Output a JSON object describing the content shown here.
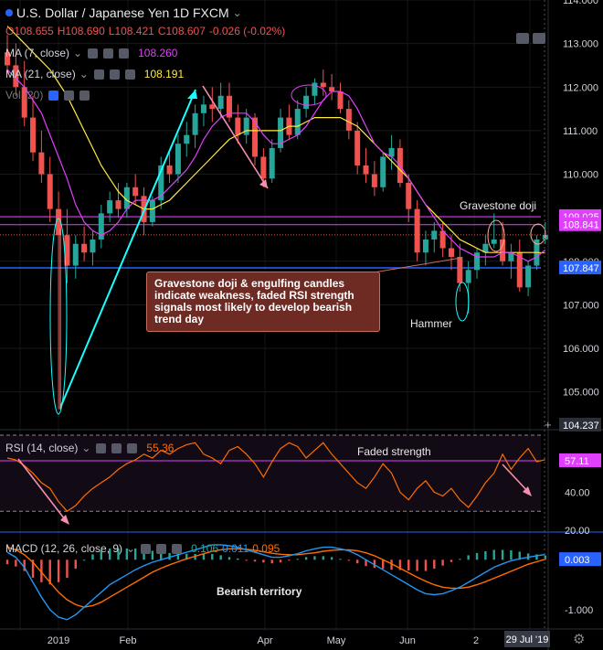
{
  "header": {
    "symbol_title": "U.S. Dollar / Japanese Yen  1D  FXCM",
    "open": "O108.655",
    "high": "H108.690",
    "low": "L108.421",
    "close": "C108.607",
    "change": "-0.026 (-0.02%)",
    "ma7_label": "MA (7, close)",
    "ma7_value": "108.260",
    "ma21_label": "MA (21, close)",
    "ma21_value": "108.191",
    "vol_label": "Vol (20)",
    "rsi_label": "RSI (14, close)",
    "rsi_value": "55.36",
    "macd_label": "MACD (12, 26, close, 9)",
    "macd_v1": "0.106",
    "macd_v2": "0.011",
    "macd_v3": "0.095"
  },
  "annotations": {
    "callout": "Gravestone doji & engulfing candles indicate weakness, faded RSI strength signals most likely to develop bearish trend day",
    "gravestone": "Gravestone doji",
    "hammer": "Hammer",
    "faded": "Faded strength",
    "bearish": "Bearish territory"
  },
  "colors": {
    "up": "#26a69a",
    "down": "#ef5350",
    "ma7": "#e040fb",
    "ma21": "#ffeb3b",
    "rsi": "#ff6d00",
    "macd": "#2196f3",
    "signal": "#ff6d00",
    "accent_blue": "#2962ff"
  },
  "icons": {
    "collapse": "chevron-down-icon",
    "settings": "gear-icon",
    "eye": "eye-icon",
    "close": "close-icon"
  },
  "chart_data": [
    {
      "type": "candlestick",
      "title": "U.S. Dollar / Japanese Yen 1D FXCM",
      "x_labels": [
        "2019",
        "Feb",
        "Apr",
        "May",
        "Jun",
        "2",
        "29 Jul '19"
      ],
      "ylim": [
        104.237,
        114.0
      ],
      "y_ticks": [
        105.0,
        106.0,
        107.0,
        108.0,
        109.0,
        110.0,
        111.0,
        112.0,
        113.0,
        114.0
      ],
      "price_tags": [
        "109.025",
        "108.841",
        "107.847",
        "104.237"
      ],
      "ohlc": [
        [
          112.8,
          113.2,
          112.3,
          112.5
        ],
        [
          112.5,
          113.0,
          111.8,
          112.0
        ],
        [
          112.0,
          112.6,
          111.1,
          111.3
        ],
        [
          111.3,
          111.8,
          110.3,
          110.5
        ],
        [
          110.5,
          111.0,
          109.8,
          110.0
        ],
        [
          110.0,
          110.4,
          108.9,
          109.2
        ],
        [
          109.2,
          109.6,
          104.6,
          108.6
        ],
        [
          108.6,
          109.2,
          107.5,
          107.9
        ],
        [
          107.9,
          108.6,
          107.6,
          108.4
        ],
        [
          108.4,
          108.8,
          108.0,
          108.2
        ],
        [
          108.2,
          108.7,
          107.9,
          108.5
        ],
        [
          108.5,
          109.3,
          108.3,
          109.1
        ],
        [
          109.1,
          109.6,
          108.9,
          109.4
        ],
        [
          109.4,
          109.8,
          109.0,
          109.2
        ],
        [
          109.2,
          109.8,
          109.0,
          109.7
        ],
        [
          109.7,
          110.0,
          109.3,
          109.5
        ],
        [
          109.5,
          109.7,
          108.6,
          108.9
        ],
        [
          108.9,
          109.5,
          108.8,
          109.4
        ],
        [
          109.4,
          110.4,
          109.2,
          110.2
        ],
        [
          110.2,
          110.5,
          109.8,
          110.0
        ],
        [
          110.0,
          110.9,
          109.8,
          110.7
        ],
        [
          110.7,
          111.2,
          110.4,
          110.9
        ],
        [
          110.9,
          111.6,
          110.6,
          111.4
        ],
        [
          111.4,
          111.8,
          111.1,
          111.6
        ],
        [
          111.6,
          112.0,
          111.2,
          111.5
        ],
        [
          111.5,
          112.1,
          111.3,
          111.8
        ],
        [
          111.8,
          112.1,
          111.2,
          111.3
        ],
        [
          111.3,
          111.6,
          110.7,
          110.9
        ],
        [
          110.9,
          111.5,
          110.7,
          111.3
        ],
        [
          111.3,
          111.4,
          110.2,
          110.4
        ],
        [
          110.4,
          110.6,
          109.7,
          109.9
        ],
        [
          109.9,
          110.8,
          109.8,
          110.6
        ],
        [
          110.6,
          111.5,
          110.5,
          111.3
        ],
        [
          111.3,
          111.6,
          110.8,
          110.9
        ],
        [
          110.9,
          111.7,
          110.8,
          111.5
        ],
        [
          111.5,
          112.0,
          111.3,
          111.8
        ],
        [
          111.8,
          112.2,
          111.6,
          112.1
        ],
        [
          112.1,
          112.4,
          111.8,
          112.0
        ],
        [
          112.0,
          112.3,
          111.7,
          111.9
        ],
        [
          111.9,
          112.1,
          111.4,
          111.5
        ],
        [
          111.5,
          111.7,
          110.8,
          111.0
        ],
        [
          111.0,
          111.2,
          110.0,
          110.2
        ],
        [
          110.2,
          110.6,
          109.8,
          110.0
        ],
        [
          110.0,
          110.3,
          109.5,
          109.7
        ],
        [
          109.7,
          110.5,
          109.6,
          110.4
        ],
        [
          110.4,
          110.9,
          110.1,
          110.6
        ],
        [
          110.6,
          110.8,
          109.7,
          109.8
        ],
        [
          109.8,
          110.0,
          108.9,
          109.2
        ],
        [
          109.2,
          109.4,
          108.0,
          108.2
        ],
        [
          108.2,
          108.7,
          107.9,
          108.5
        ],
        [
          108.5,
          108.9,
          108.2,
          108.7
        ],
        [
          108.7,
          108.9,
          108.1,
          108.3
        ],
        [
          108.3,
          108.6,
          107.8,
          108.1
        ],
        [
          108.1,
          108.4,
          107.3,
          107.5
        ],
        [
          107.5,
          108.0,
          106.8,
          107.8
        ],
        [
          107.8,
          108.3,
          107.6,
          108.2
        ],
        [
          108.2,
          108.6,
          107.9,
          108.4
        ],
        [
          108.4,
          109.1,
          108.3,
          108.5
        ],
        [
          108.5,
          108.9,
          107.9,
          108.0
        ],
        [
          108.0,
          108.4,
          107.6,
          108.2
        ],
        [
          108.2,
          108.5,
          107.3,
          107.4
        ],
        [
          107.4,
          108.0,
          107.2,
          107.9
        ],
        [
          107.9,
          108.6,
          107.8,
          108.5
        ],
        [
          108.5,
          108.9,
          108.4,
          108.607
        ]
      ],
      "ma7": [
        112.4,
        112.2,
        112.0,
        111.7,
        111.4,
        110.9,
        110.4,
        109.9,
        109.3,
        108.9,
        108.7,
        108.6,
        108.7,
        108.9,
        109.2,
        109.4,
        109.4,
        109.4,
        109.5,
        109.7,
        109.9,
        110.1,
        110.4,
        110.8,
        111.1,
        111.3,
        111.4,
        111.4,
        111.4,
        111.2,
        110.9,
        110.7,
        110.7,
        110.8,
        110.9,
        111.1,
        111.4,
        111.7,
        111.9,
        111.9,
        111.8,
        111.5,
        111.1,
        110.7,
        110.5,
        110.4,
        110.2,
        109.9,
        109.6,
        109.3,
        109.0,
        108.7,
        108.5,
        108.3,
        108.2,
        108.1,
        108.1,
        108.1,
        108.2,
        108.2,
        108.1,
        108.0,
        108.1,
        108.26
      ],
      "ma21": [
        113.4,
        113.2,
        113.0,
        112.8,
        112.6,
        112.4,
        112.1,
        111.8,
        111.4,
        111.0,
        110.6,
        110.2,
        109.9,
        109.6,
        109.4,
        109.3,
        109.2,
        109.2,
        109.3,
        109.4,
        109.6,
        109.8,
        110.0,
        110.2,
        110.4,
        110.6,
        110.8,
        110.9,
        111.0,
        111.0,
        111.0,
        111.0,
        111.0,
        111.1,
        111.1,
        111.2,
        111.3,
        111.3,
        111.3,
        111.3,
        111.2,
        111.1,
        110.9,
        110.7,
        110.5,
        110.3,
        110.1,
        109.9,
        109.6,
        109.3,
        109.1,
        108.9,
        108.7,
        108.5,
        108.4,
        108.3,
        108.2,
        108.2,
        108.2,
        108.2,
        108.2,
        108.2,
        108.2,
        108.191
      ]
    },
    {
      "type": "line",
      "title": "RSI (14, close)",
      "ylim": [
        20,
        70
      ],
      "y_ticks": [
        20.0,
        40.0
      ],
      "reference_levels": [
        70,
        30
      ],
      "value_tag": "57.11",
      "values": [
        58,
        57,
        54,
        50,
        45,
        42,
        35,
        30,
        33,
        38,
        42,
        45,
        48,
        52,
        55,
        57,
        60,
        58,
        62,
        60,
        63,
        65,
        66,
        60,
        58,
        55,
        62,
        64,
        60,
        55,
        48,
        56,
        63,
        66,
        64,
        58,
        62,
        66,
        60,
        55,
        50,
        45,
        42,
        48,
        55,
        50,
        40,
        36,
        42,
        46,
        40,
        38,
        42,
        36,
        32,
        38,
        45,
        50,
        60,
        52,
        58,
        63,
        56,
        57.11
      ]
    },
    {
      "type": "line",
      "title": "MACD (12, 26, close, 9)",
      "ylim": [
        -1.35,
        0.5
      ],
      "y_ticks": [
        -1.0,
        0.003
      ],
      "value_tag": "0.003",
      "macd": [
        0.15,
        0.05,
        -0.15,
        -0.45,
        -0.75,
        -1.0,
        -1.15,
        -1.2,
        -1.1,
        -0.95,
        -0.8,
        -0.65,
        -0.5,
        -0.4,
        -0.3,
        -0.2,
        -0.12,
        -0.05,
        0.0,
        0.05,
        0.1,
        0.15,
        0.2,
        0.25,
        0.3,
        0.3,
        0.28,
        0.25,
        0.2,
        0.15,
        0.1,
        0.05,
        0.05,
        0.08,
        0.12,
        0.18,
        0.22,
        0.25,
        0.25,
        0.22,
        0.18,
        0.1,
        0.0,
        -0.1,
        -0.2,
        -0.3,
        -0.4,
        -0.5,
        -0.6,
        -0.68,
        -0.7,
        -0.68,
        -0.62,
        -0.55,
        -0.45,
        -0.35,
        -0.25,
        -0.15,
        -0.08,
        -0.02,
        0.02,
        0.05,
        0.08,
        0.106
      ],
      "signal": [
        0.25,
        0.2,
        0.1,
        -0.05,
        -0.25,
        -0.45,
        -0.65,
        -0.8,
        -0.9,
        -0.95,
        -0.92,
        -0.85,
        -0.75,
        -0.65,
        -0.55,
        -0.45,
        -0.35,
        -0.25,
        -0.17,
        -0.1,
        -0.04,
        0.02,
        0.07,
        0.12,
        0.17,
        0.2,
        0.22,
        0.22,
        0.21,
        0.19,
        0.16,
        0.13,
        0.11,
        0.1,
        0.1,
        0.12,
        0.14,
        0.17,
        0.19,
        0.2,
        0.2,
        0.18,
        0.14,
        0.08,
        0.0,
        -0.08,
        -0.17,
        -0.26,
        -0.35,
        -0.43,
        -0.5,
        -0.55,
        -0.57,
        -0.57,
        -0.55,
        -0.5,
        -0.44,
        -0.37,
        -0.3,
        -0.23,
        -0.16,
        -0.09,
        -0.04,
        0.011
      ]
    }
  ]
}
